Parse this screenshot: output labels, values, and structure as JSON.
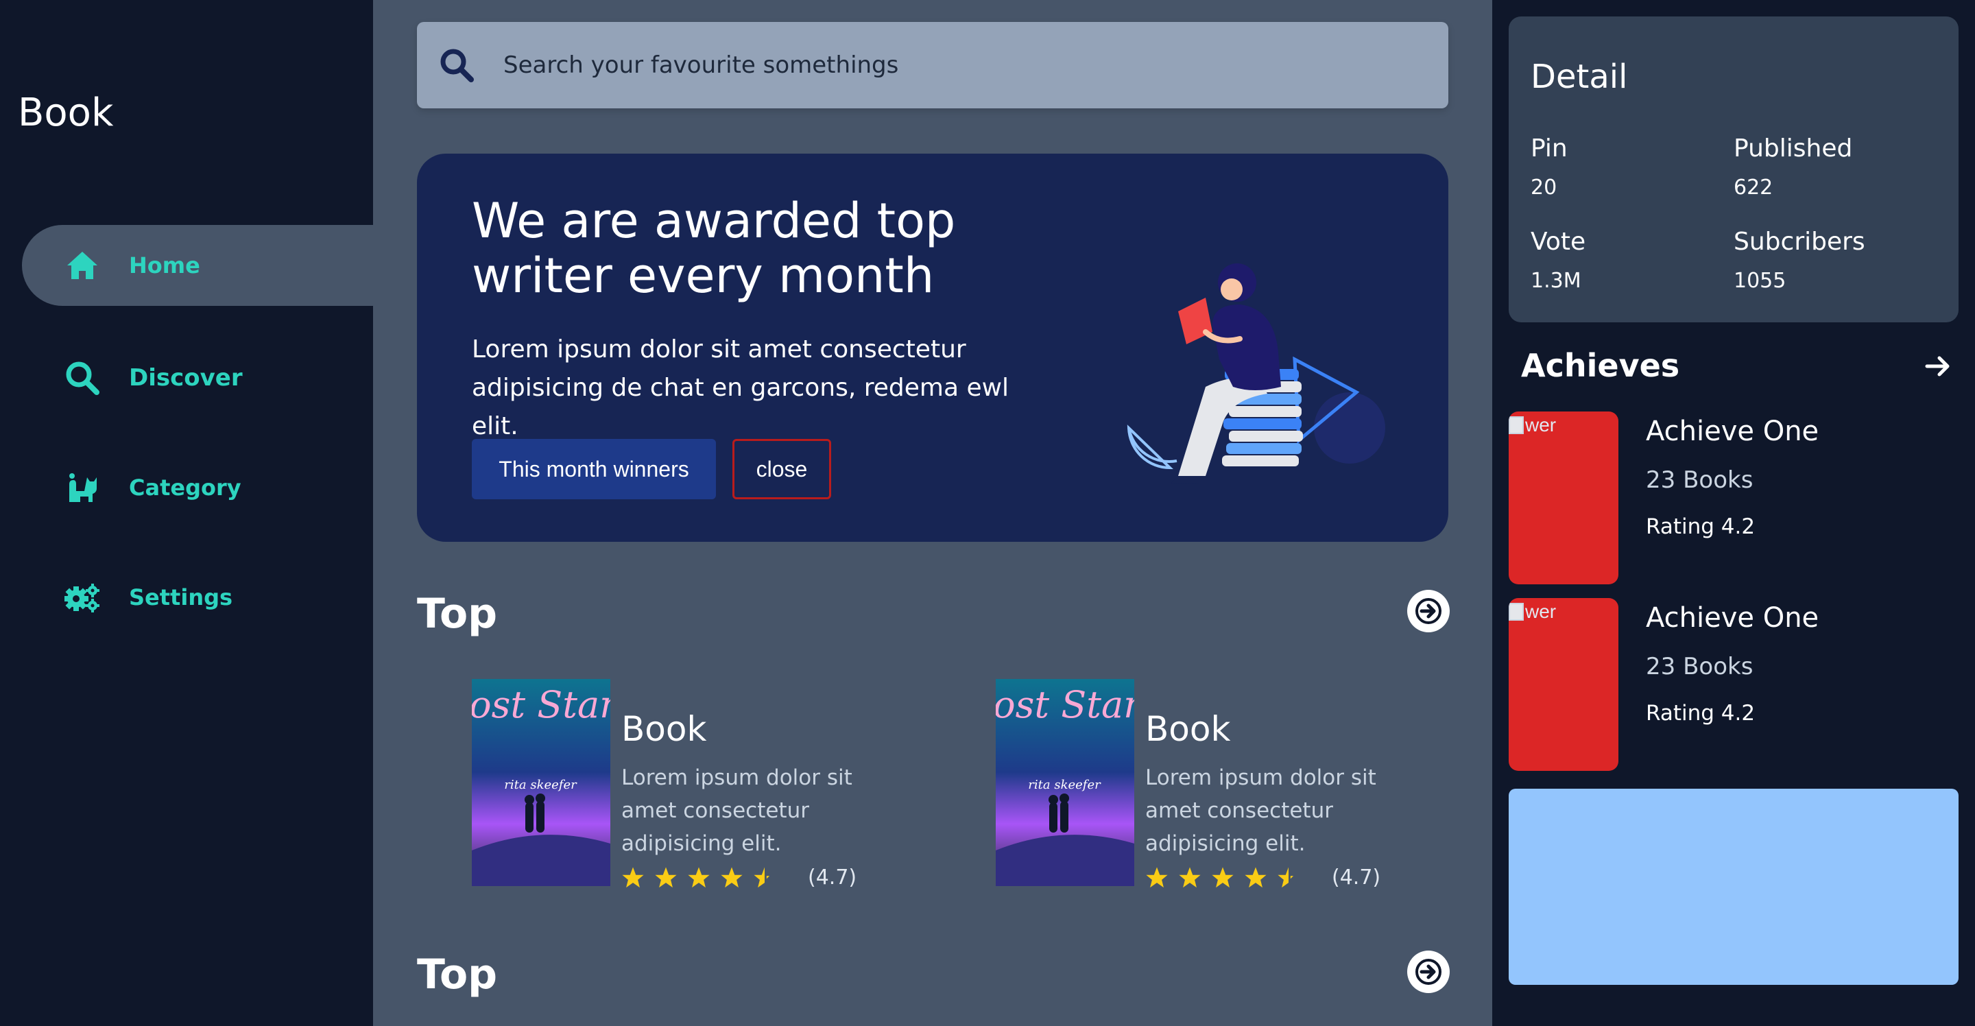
{
  "sidebar": {
    "brand": "Book",
    "items": [
      {
        "label": "Home",
        "icon": "home-icon",
        "active": true
      },
      {
        "label": "Discover",
        "icon": "search-icon",
        "active": false
      },
      {
        "label": "Category",
        "icon": "cat-icon",
        "active": false
      },
      {
        "label": "Settings",
        "icon": "gears-icon",
        "active": false
      }
    ]
  },
  "search": {
    "placeholder": "Search your favourite somethings"
  },
  "banner": {
    "title": "We are awarded top writer every month",
    "text": "Lorem ipsum dolor sit amet consectetur adipisicing de chat en garcons, redema ewl elit.",
    "primary_button": "This month winners",
    "secondary_button": "close"
  },
  "sections": [
    {
      "title": "Top",
      "books": [
        {
          "title": "Book",
          "description": "Lorem ipsum dolor sit amet consectetur adipisicing elit.",
          "rating": 4.5,
          "rating_label": "(4.7)",
          "cover_title": "Lost Stars",
          "cover_author": "rita skeefer"
        },
        {
          "title": "Book",
          "description": "Lorem ipsum dolor sit amet consectetur adipisicing elit.",
          "rating": 4.5,
          "rating_label": "(4.7)",
          "cover_title": "Lost Stars",
          "cover_author": "rita skeefer"
        }
      ]
    },
    {
      "title": "Top",
      "books": []
    }
  ],
  "detail": {
    "title": "Detail",
    "stats": [
      {
        "label": "Pin",
        "value": "20"
      },
      {
        "label": "Published",
        "value": "622"
      },
      {
        "label": "Vote",
        "value": "1.3M"
      },
      {
        "label": "Subcribers",
        "value": "1055"
      }
    ]
  },
  "achieves": {
    "title": "Achieves",
    "items": [
      {
        "image_alt": "wer",
        "name": "Achieve One",
        "books": "23 Books",
        "rating": "Rating 4.2"
      },
      {
        "image_alt": "wer",
        "name": "Achieve One",
        "books": "23 Books",
        "rating": "Rating 4.2"
      }
    ]
  },
  "colors": {
    "sidebar_bg": "#0f172a",
    "main_bg": "#475569",
    "accent": "#2dd4bf",
    "banner_bg": "#172554",
    "primary_button": "#1e3a8a",
    "danger": "#b91c1c",
    "achieve_card": "#dc2626",
    "info_box": "#93c5fd",
    "star": "#facc15"
  }
}
